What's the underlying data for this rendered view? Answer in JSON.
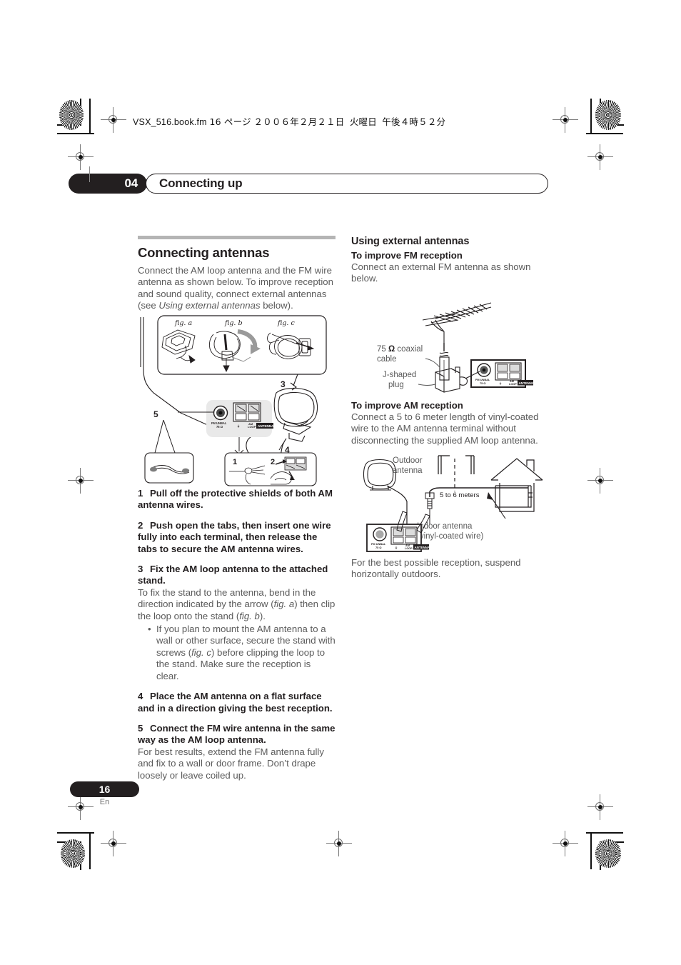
{
  "header": {
    "filename": "VSX_516.book.fm",
    "page_label": "16 ページ",
    "date": "２００６年２月２１日",
    "weekday": "火曜日",
    "time": "午後４時５２分"
  },
  "chapter": {
    "number": "04",
    "title": "Connecting up"
  },
  "left_column": {
    "section_title": "Connecting antennas",
    "intro_1": "Connect the AM loop antenna and the FM wire antenna as shown below. To improve reception and sound quality, connect external antennas (see ",
    "intro_italic": "Using external antennas",
    "intro_2": " below).",
    "steps": [
      {
        "number": "1",
        "bold": "Pull off the protective shields of both AM antenna wires.",
        "body": ""
      },
      {
        "number": "2",
        "bold": "Push open the tabs, then insert one wire fully into each terminal, then release the tabs to secure the AM antenna wires.",
        "body": ""
      },
      {
        "number": "3",
        "bold": "Fix the AM loop antenna to the attached stand.",
        "body_pre": "To fix the stand to the antenna, bend in the direction indicated by the arrow (",
        "body_it1": "fig. a",
        "body_mid": ") then clip the loop onto the stand (",
        "body_it2": "fig. b",
        "body_post": ")."
      },
      {
        "number": "4",
        "bold": "Place the AM antenna on a flat surface and in a direction giving the best reception.",
        "body": ""
      },
      {
        "number": "5",
        "bold": "Connect the FM wire antenna in the same way as the AM loop antenna.",
        "body": "For best results, extend the FM antenna fully and fix to a wall or door frame. Don’t drape loosely or leave coiled up."
      }
    ],
    "bullet": {
      "pre": "If you plan to mount the AM antenna to a wall or other surface, secure the stand with screws (",
      "it": "fig. c",
      "post": ") before clipping the loop to the stand. Make sure the reception is clear."
    }
  },
  "right_column": {
    "section_title": "Using external antennas",
    "fm_heading": "To improve FM reception",
    "fm_body": "Connect an external FM antenna as shown below.",
    "am_heading": "To improve AM reception",
    "am_body": "Connect a 5 to 6 meter length of vinyl-coated wire to the AM antenna terminal without disconnecting the supplied AM loop antenna.",
    "closing_body": "For the best possible reception, suspend horizontally outdoors."
  },
  "figure_main": {
    "fig_a": "fig. a",
    "fig_b": "fig. b",
    "fig_c": "fig. c",
    "callout_1": "1",
    "callout_2": "2",
    "callout_3": "3",
    "callout_4": "4",
    "callout_5": "5",
    "terminal": {
      "fm_unbal_line1": "FM UNBAL",
      "fm_unbal_line2": "75 Ω",
      "ground": "⏚",
      "am_loop_line1": "AM",
      "am_loop_line2": "LOOP",
      "antenna_label": "ANTENNA"
    }
  },
  "figure_fm": {
    "label_coax_line1": "75 Ω coaxial",
    "label_coax_line2": "cable",
    "label_plug_line1": "J-shaped",
    "label_plug_line2": "plug",
    "terminal": {
      "fm_unbal_line1": "FM UNBAL",
      "fm_unbal_line2": "75 Ω",
      "am_loop_line1": "AM",
      "am_loop_line2": "LOOP",
      "antenna_label": "ANTENNA"
    }
  },
  "figure_am": {
    "label_outdoor_line1": "Outdoor",
    "label_outdoor_line2": "antenna",
    "label_meters": "5 to 6 meters",
    "label_indoor_line1": "Indoor antenna",
    "label_indoor_line2": "(vinyl-coated wire)",
    "terminal": {
      "fm_unbal_line1": "FM UNBAL",
      "fm_unbal_line2": "75 Ω",
      "am_loop_line1": "AM",
      "am_loop_line2": "LOOP",
      "antenna_label": "ANTENNA"
    }
  },
  "footer": {
    "page_number": "16",
    "language": "En"
  },
  "colors": {
    "ink": "#231f20",
    "body_text": "#5a5a5a",
    "rule": "#b5b5b5",
    "panel_gray": "#e9e9e9"
  }
}
